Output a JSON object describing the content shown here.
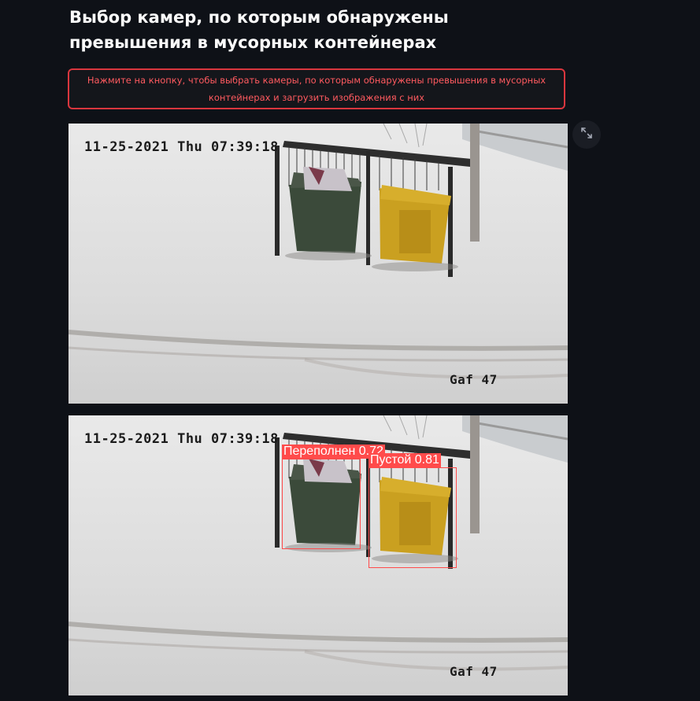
{
  "page": {
    "title": "Выбор камер, по которым обнаружены превышения в мусорных контейнерах"
  },
  "notice_button": {
    "label": "Нажмите на кнопку, чтобы выбрать камеры, по которым обнаружены превышения в мусорных контейнерах и загрузить изображения с них"
  },
  "fullscreen": {
    "icon": "expand-icon"
  },
  "images": [
    {
      "timestamp": "11-25-2021 Thu 07:39:18",
      "camera": "Gaf 47"
    },
    {
      "timestamp": "11-25-2021 Thu 07:39:18",
      "camera": "Gaf 47",
      "detections": [
        {
          "label": "Переполнен 0.72"
        },
        {
          "label": "Пустой 0.81"
        }
      ]
    }
  ],
  "colors": {
    "background": "#0e1117",
    "alert": "#ff4b4b",
    "title": "#fafafa"
  }
}
